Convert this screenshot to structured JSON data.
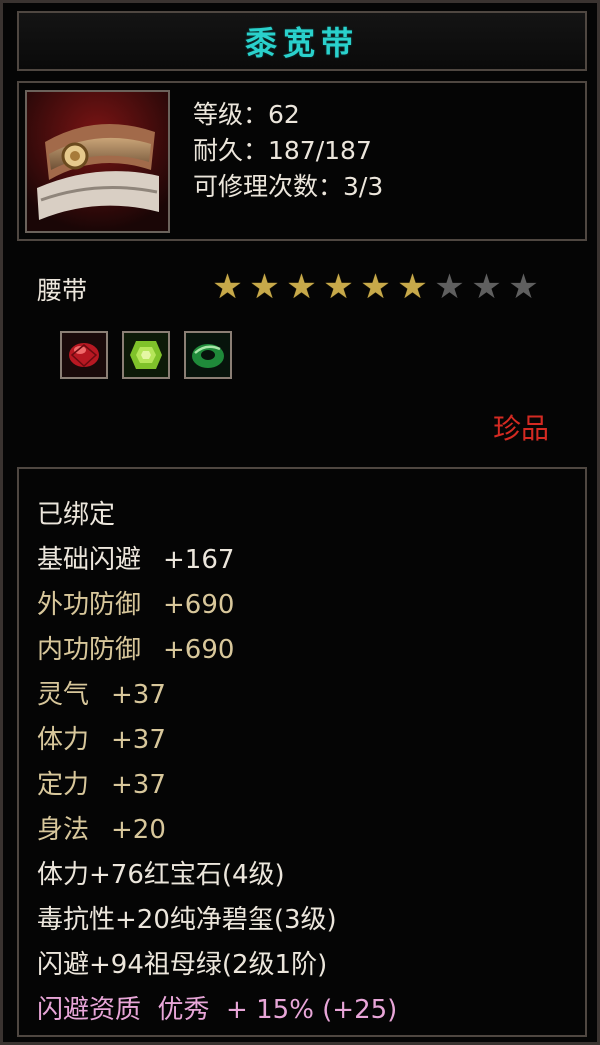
{
  "item": {
    "name": "黍宽带",
    "level_line": "等级：62",
    "durability_line": "耐久：187/187",
    "repair_line": "可修理次数：3/3",
    "type": "腰带",
    "stars": {
      "filled": 6,
      "total": 9
    },
    "gems": [
      {
        "name": "红宝石",
        "icon": "ruby-gem-icon",
        "color": "#c8202a"
      },
      {
        "name": "纯净碧玺",
        "icon": "tourmaline-gem-icon",
        "color": "#7fc22a"
      },
      {
        "name": "祖母绿",
        "icon": "emerald-gem-icon",
        "color": "#1f8a3a"
      }
    ],
    "rarity": "珍品"
  },
  "attributes": {
    "bound": "已绑定",
    "rows": [
      {
        "name": "基础闪避",
        "value": "+167",
        "color": "white"
      },
      {
        "name": "外功防御",
        "value": "+690",
        "color": "gold"
      },
      {
        "name": "内功防御",
        "value": "+690",
        "color": "gold"
      },
      {
        "name": "灵气",
        "value": "+37",
        "color": "gold"
      },
      {
        "name": "体力",
        "value": "+37",
        "color": "gold"
      },
      {
        "name": "定力",
        "value": "+37",
        "color": "gold"
      },
      {
        "name": "身法",
        "value": "+20",
        "color": "gold"
      }
    ],
    "gem_lines": [
      "体力+76红宝石(4级)",
      "毒抗性+20纯净碧玺(3级)",
      "闪避+94祖母绿(2级1阶)"
    ],
    "aptitude": "闪避资质  优秀  + 15% (+25)"
  },
  "colors": {
    "title": "#2ad1cc",
    "white_text": "#ece6dc",
    "gold_text": "#d8c79b",
    "rarity": "#d42a22",
    "aptitude": "#e8a6d8"
  }
}
